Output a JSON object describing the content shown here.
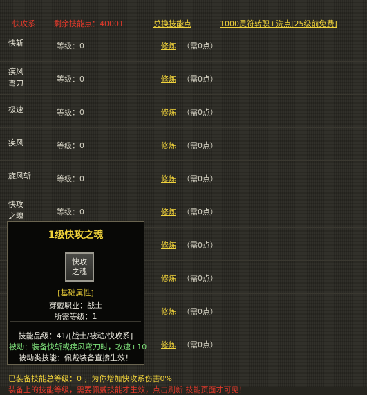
{
  "header": {
    "category": "快攻系",
    "remaining_points": "剩余技能点：40001",
    "exchange_link": "兑换技能点",
    "reset_link": "1000灵符转职+洗点[25级前免费]"
  },
  "skills": [
    {
      "name": "快斩",
      "level": "等级：0",
      "train": "修炼",
      "cost": "（需0点）"
    },
    {
      "name": "疾风\n弯刀",
      "level": "等级：0",
      "train": "修炼",
      "cost": "（需0点）"
    },
    {
      "name": "极速",
      "level": "等级：0",
      "train": "修炼",
      "cost": "（需0点）"
    },
    {
      "name": "疾风",
      "level": "等级：0",
      "train": "修炼",
      "cost": "（需0点）"
    },
    {
      "name": "旋风斩",
      "level": "等级：0",
      "train": "修炼",
      "cost": "（需0点）"
    },
    {
      "name": "快攻\n之魂",
      "level": "等级：0",
      "train": "修炼",
      "cost": "（需0点）"
    },
    {
      "name": "",
      "level": "等级：0",
      "train": "修炼",
      "cost": "（需0点）"
    },
    {
      "name": "",
      "level": "等级：0",
      "train": "修炼",
      "cost": "（需0点）"
    },
    {
      "name": "",
      "level": "等级：0",
      "train": "修炼",
      "cost": "（需0点）"
    },
    {
      "name": "",
      "level": "等级：0",
      "train": "修炼",
      "cost": "（需0点）"
    }
  ],
  "tooltip": {
    "title": "1级快攻之魂",
    "icon_text": "快攻\n之魂",
    "section": "[基础属性]",
    "profession": "穿戴职业：战士",
    "required_level": "所需等级：1",
    "grade": "技能品级：41/[战士/被动/快攻系]",
    "passive_desc": "被动：装备快斩或疾风弯刀时，攻速+10",
    "passive_note": "被动类技能：佩戴装备直接生效！"
  },
  "footer": {
    "summary": "已装备技能总等级：0  ，为你增加快攻系伤害0%",
    "warning": "装备上的技能等级，需要佩戴技能才生效，点击刷新  技能页面才可见！"
  },
  "colors": {
    "red": "#e0392b",
    "yellow": "#f0d23a",
    "green": "#7ee07a"
  }
}
